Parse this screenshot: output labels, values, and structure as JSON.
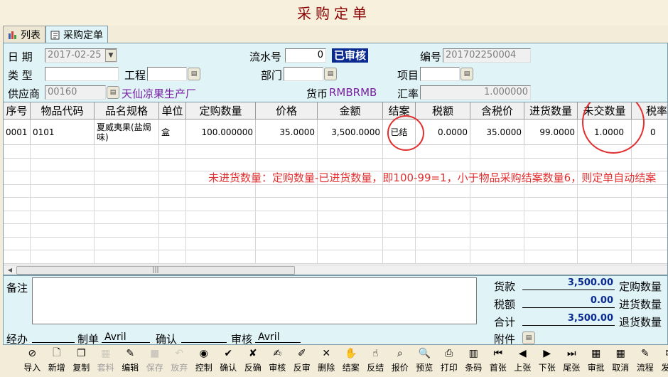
{
  "window": {
    "title": "采购定单"
  },
  "tabs": [
    {
      "label": "列表"
    },
    {
      "label": "采购定单"
    }
  ],
  "form": {
    "date_label": "日  期",
    "date_value": "2017-02-25",
    "serial_label": "流水号",
    "serial_value": "0",
    "status": "已审核",
    "number_label": "编号",
    "number_value": "201702250004",
    "type_label": "类  型",
    "type_value": "",
    "project_label": "工程",
    "project_value": "",
    "dept_label": "部门",
    "dept_value": "",
    "item_label": "项目",
    "item_value": "",
    "supplier_label": "供应商",
    "supplier_code": "00160",
    "supplier_name": "天仙凉果生产厂",
    "currency_label": "货币",
    "currency_value": "RMBRMB",
    "rate_label": "汇率",
    "rate_value": "1.000000"
  },
  "grid": {
    "headers": [
      "序号",
      "物品代码",
      "品名规格",
      "单位",
      "定购数量",
      "价格",
      "金额",
      "结案",
      "税额",
      "含税价",
      "进货数量",
      "未交数量",
      "税率"
    ],
    "rows": [
      [
        "0001",
        "0101",
        "夏威夷果(盐焗味)",
        "盒",
        "100.000000",
        "35.0000",
        "3,500.0000",
        "已结",
        "0.0000",
        "35.0000",
        "99.0000",
        "1.0000",
        "0"
      ]
    ],
    "annotation": "未进货数量：定购数量-已进货数量，即100-99=1，小于物品采购结案数量6，则定单自动结案"
  },
  "bottom": {
    "memo_label": "备注",
    "memo_value": "",
    "goods_label": "货款",
    "goods_value": "3,500.00",
    "tax_label": "税额",
    "tax_value": "0.00",
    "total_label": "合计",
    "total_value": "3,500.00",
    "order_qty_label": "定购数量",
    "in_qty_label": "进货数量",
    "return_qty_label": "退货数量",
    "handler_label": "经办",
    "handler_value": "",
    "maker_label": "制单",
    "maker_value": "Avril",
    "confirm_label": "确认",
    "confirm_value": "",
    "audit_label": "审核",
    "audit_value": "Avril",
    "attach_label": "附件"
  },
  "toolbar": [
    {
      "label": "导入",
      "icon": "import-icon"
    },
    {
      "label": "新增",
      "icon": "new-icon"
    },
    {
      "label": "复制",
      "icon": "copy-icon"
    },
    {
      "label": "套料",
      "icon": "material-icon",
      "disabled": true
    },
    {
      "label": "编辑",
      "icon": "edit-icon"
    },
    {
      "label": "保存",
      "icon": "save-icon",
      "disabled": true
    },
    {
      "label": "放弃",
      "icon": "undo-icon",
      "disabled": true
    },
    {
      "label": "控制",
      "icon": "control-icon"
    },
    {
      "label": "确认",
      "icon": "confirm-icon"
    },
    {
      "label": "反确",
      "icon": "unconfirm-icon"
    },
    {
      "label": "审核",
      "icon": "audit-icon"
    },
    {
      "label": "反审",
      "icon": "unaudit-icon"
    },
    {
      "label": "删除",
      "icon": "delete-icon"
    },
    {
      "label": "结案",
      "icon": "close-case-icon"
    },
    {
      "label": "反结",
      "icon": "reopen-icon"
    },
    {
      "label": "报价",
      "icon": "quote-icon"
    },
    {
      "label": "预览",
      "icon": "preview-icon"
    },
    {
      "label": "打印",
      "icon": "print-icon"
    },
    {
      "label": "条码",
      "icon": "barcode-icon"
    },
    {
      "label": "首张",
      "icon": "first-icon"
    },
    {
      "label": "上张",
      "icon": "prev-icon"
    },
    {
      "label": "下张",
      "icon": "next-icon"
    },
    {
      "label": "尾张",
      "icon": "last-icon"
    },
    {
      "label": "审批",
      "icon": "approve-icon"
    },
    {
      "label": "取消",
      "icon": "cancel-icon"
    },
    {
      "label": "流程",
      "icon": "flow-icon"
    },
    {
      "label": "发送",
      "icon": "send-icon"
    }
  ]
}
